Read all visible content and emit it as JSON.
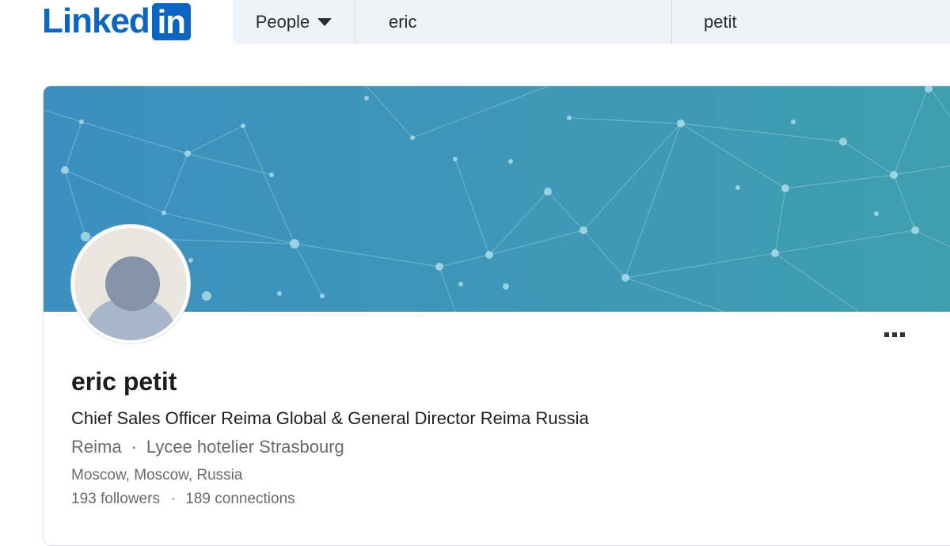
{
  "header": {
    "logo": {
      "word": "Linked",
      "box": "in"
    },
    "search_type": "People",
    "first_name": "eric",
    "last_name": "petit"
  },
  "profile": {
    "name": "eric petit",
    "headline": "Chief Sales Officer Reima Global & General Director Reima Russia",
    "company": "Reima",
    "school": "Lycee hotelier Strasbourg",
    "separator": "·",
    "location": "Moscow, Moscow, Russia",
    "followers": "193 followers",
    "connections": "189 connections"
  },
  "colors": {
    "brand": "#0a66c2",
    "banner_start": "#3c8fbf",
    "banner_end": "#3f9fae"
  },
  "icons": {
    "type_caret": "chevron-down-icon",
    "more": "ellipsis-icon",
    "avatar": "default-avatar-icon"
  }
}
